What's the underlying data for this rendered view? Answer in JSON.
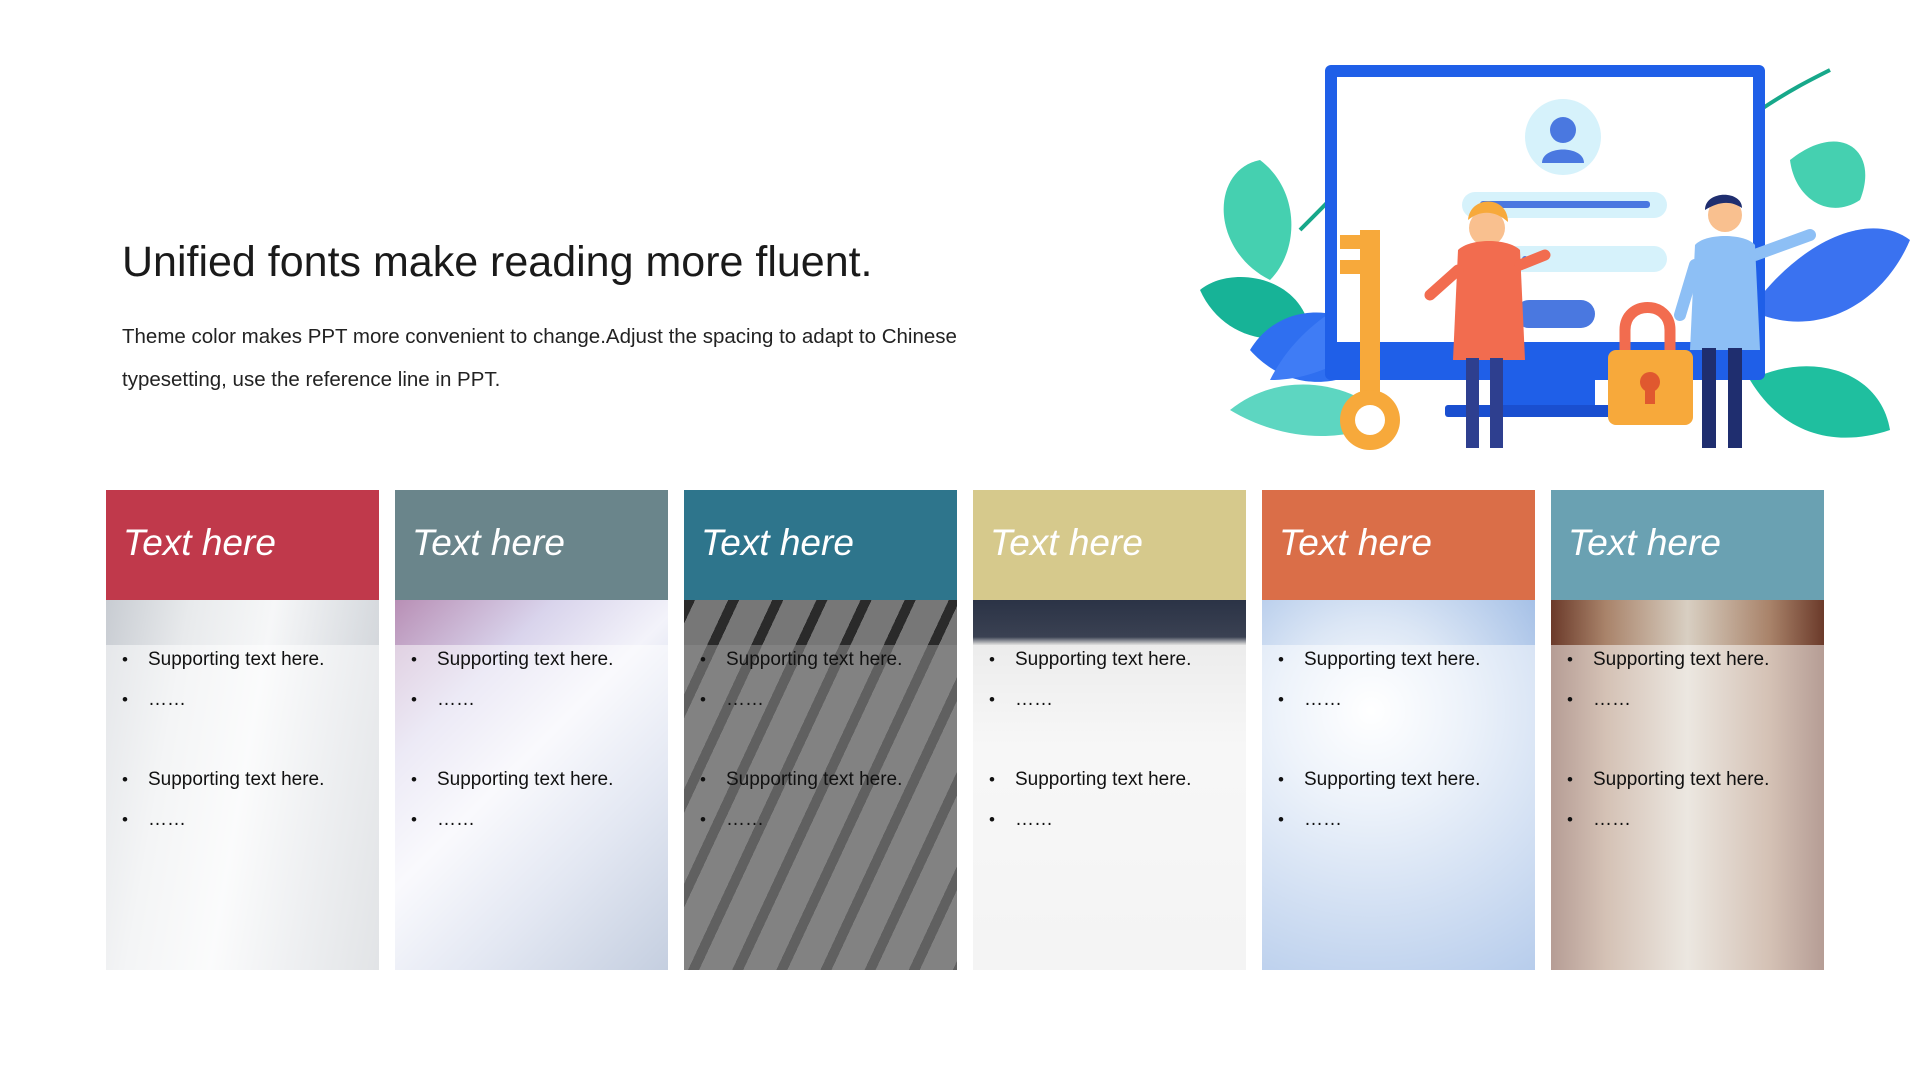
{
  "heading": "Unified fonts make reading more fluent.",
  "description": "Theme color makes PPT more convenient to change.Adjust the spacing to adapt to Chinese typesetting, use the reference line in PPT.",
  "illustration": {
    "icons": [
      "monitor-icon",
      "user-avatar-icon",
      "key-icon",
      "padlock-icon",
      "woman-figure-icon",
      "man-figure-icon",
      "leaf-decoration-icon"
    ]
  },
  "cards": [
    {
      "title": "Text here",
      "color": "#c0394b",
      "photo": "corridor",
      "bullets": [
        "Supporting text here.",
        "……",
        "Supporting text here.",
        "……"
      ]
    },
    {
      "title": "Text here",
      "color": "#6a858b",
      "photo": "skyscraper",
      "bullets": [
        "Supporting text here.",
        "……",
        "Supporting text here.",
        "……"
      ]
    },
    {
      "title": "Text here",
      "color": "#2e758c",
      "photo": "building-grayscale",
      "bullets": [
        "Supporting text here.",
        "……",
        "Supporting text here.",
        "……"
      ]
    },
    {
      "title": "Text here",
      "color": "#d6c98c",
      "photo": "desk",
      "bullets": [
        "Supporting text here.",
        "……",
        "Supporting text here.",
        "……"
      ]
    },
    {
      "title": "Text here",
      "color": "#da6e48",
      "photo": "sky",
      "bullets": [
        "Supporting text here.",
        "……",
        "Supporting text here.",
        "……"
      ]
    },
    {
      "title": "Text here",
      "color": "#6aa1b2",
      "photo": "canal-city",
      "bullets": [
        "Supporting text here.",
        "……",
        "Supporting text here.",
        "……"
      ]
    }
  ]
}
